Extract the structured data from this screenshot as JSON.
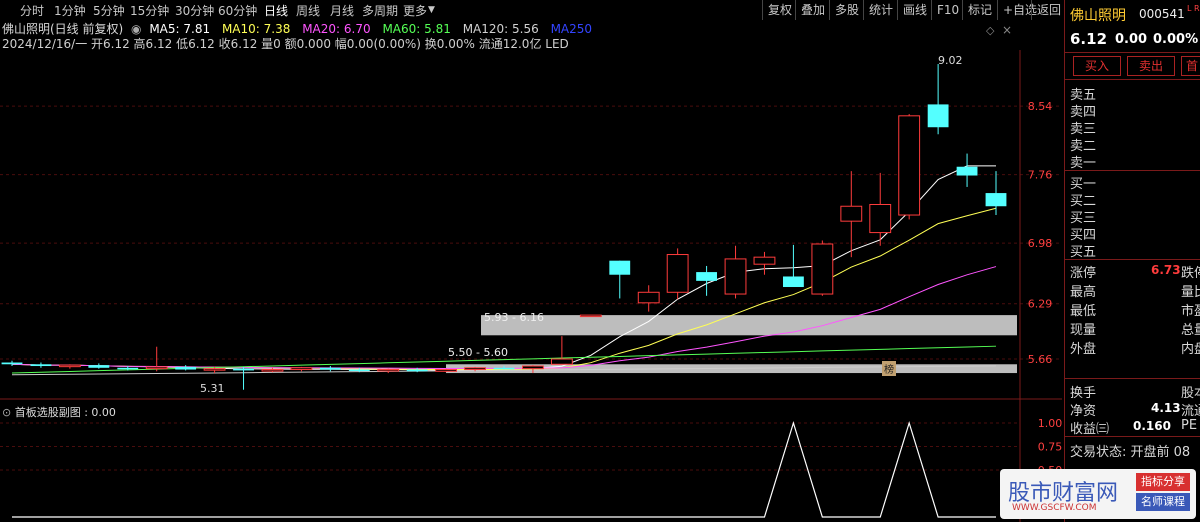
{
  "periods": [
    "分时",
    "1分钟",
    "5分钟",
    "15分钟",
    "30分钟",
    "60分钟",
    "日线",
    "周线",
    "月线",
    "多周期",
    "更多"
  ],
  "active_period": "日线",
  "toolbar": [
    "复权",
    "叠加",
    "多股",
    "统计",
    "画线",
    "F10",
    "标记",
    "+自选",
    "返回"
  ],
  "title": {
    "name": "佛山照明(日线 前复权)",
    "ma5": "MA5: 7.81",
    "ma10": "MA10: 7.38",
    "ma20": "MA20: 6.70",
    "ma60": "MA60: 5.81",
    "ma120": "MA120: 5.56",
    "ma250": "MA250"
  },
  "info": "2024/12/16/一 开6.12 高6.12 低6.12 收6.12 量0 额0.000 幅0.00(0.00%) 换0.00% 流通12.0亿 LED",
  "y_labels": [
    "8.54",
    "7.76",
    "6.98",
    "6.29",
    "5.66"
  ],
  "annotations": {
    "high": "9.02",
    "low": "5.31",
    "zone1": "5.93 - 6.16",
    "zone2": "5.50 - 5.60",
    "bang": "榜"
  },
  "sub": {
    "title": "首板选股副图 : 0.00",
    "labels": [
      "1.00",
      "0.75",
      "0.50"
    ]
  },
  "right": {
    "name": "佛山照明",
    "code": "000541",
    "tag": "L R",
    "price": "6.12",
    "change": "0.00",
    "pct": "0.00%",
    "buy": "买入",
    "sell": "卖出",
    "more": "首",
    "sells": [
      "卖五",
      "卖四",
      "卖三",
      "卖二",
      "卖一"
    ],
    "buys": [
      "买一",
      "买二",
      "买三",
      "买四",
      "买五"
    ],
    "stats": [
      {
        "label": "涨停",
        "value": "6.73",
        "tail": "跌停"
      },
      {
        "label": "最高",
        "value": "",
        "tail": "量比"
      },
      {
        "label": "最低",
        "value": "",
        "tail": "市盈"
      },
      {
        "label": "现量",
        "value": "",
        "tail": "总量"
      },
      {
        "label": "外盘",
        "value": "",
        "tail": "内盘"
      }
    ],
    "stats2": [
      {
        "label": "换手",
        "value": "",
        "tail": "股本"
      },
      {
        "label": "净资",
        "value": "4.13",
        "tail": "流通"
      },
      {
        "label": "收益㈢",
        "value": "0.160",
        "tail": "PE"
      }
    ],
    "trade_state": "交易状态: 开盘前 08"
  },
  "watermark": {
    "main": "股市财富网",
    "sub1": "指标分享",
    "sub2": "名师课程",
    "url": "WWW.GSCFW.COM"
  },
  "colors": {
    "up": "#ff3c3c",
    "down": "#54ffff",
    "ma5": "#ffffff",
    "ma10": "#ffff55",
    "ma20": "#ff55ff",
    "ma60": "#55ff55",
    "ma120": "#cccccc",
    "grid": "#4a0d0d",
    "axis_text": "#ff4040"
  },
  "chart_data": {
    "type": "candlestick",
    "ylim": [
      5.25,
      9.1
    ],
    "candles": [
      {
        "o": 5.62,
        "h": 5.64,
        "l": 5.58,
        "c": 5.6
      },
      {
        "o": 5.6,
        "h": 5.62,
        "l": 5.56,
        "c": 5.58
      },
      {
        "o": 5.58,
        "h": 5.6,
        "l": 5.55,
        "c": 5.59
      },
      {
        "o": 5.59,
        "h": 5.61,
        "l": 5.55,
        "c": 5.56
      },
      {
        "o": 5.56,
        "h": 5.58,
        "l": 5.53,
        "c": 5.55
      },
      {
        "o": 5.55,
        "h": 5.8,
        "l": 5.52,
        "c": 5.57
      },
      {
        "o": 5.57,
        "h": 5.59,
        "l": 5.53,
        "c": 5.54
      },
      {
        "o": 5.54,
        "h": 5.57,
        "l": 5.5,
        "c": 5.55
      },
      {
        "o": 5.55,
        "h": 5.57,
        "l": 5.31,
        "c": 5.53
      },
      {
        "o": 5.53,
        "h": 5.56,
        "l": 5.51,
        "c": 5.54
      },
      {
        "o": 5.54,
        "h": 5.57,
        "l": 5.52,
        "c": 5.56
      },
      {
        "o": 5.56,
        "h": 5.58,
        "l": 5.52,
        "c": 5.54
      },
      {
        "o": 5.54,
        "h": 5.56,
        "l": 5.51,
        "c": 5.53
      },
      {
        "o": 5.53,
        "h": 5.55,
        "l": 5.5,
        "c": 5.54
      },
      {
        "o": 5.54,
        "h": 5.56,
        "l": 5.51,
        "c": 5.52
      },
      {
        "o": 5.52,
        "h": 5.55,
        "l": 5.51,
        "c": 5.54
      },
      {
        "o": 5.54,
        "h": 5.57,
        "l": 5.52,
        "c": 5.56
      },
      {
        "o": 5.56,
        "h": 5.58,
        "l": 5.54,
        "c": 5.55
      },
      {
        "o": 5.55,
        "h": 5.59,
        "l": 5.5,
        "c": 5.58
      },
      {
        "o": 5.6,
        "h": 5.92,
        "l": 5.6,
        "c": 5.66
      },
      {
        "o": 6.16,
        "h": 6.16,
        "l": 6.16,
        "c": 6.16
      },
      {
        "o": 6.78,
        "h": 6.78,
        "l": 6.35,
        "c": 6.62
      },
      {
        "o": 6.3,
        "h": 6.5,
        "l": 6.2,
        "c": 6.42
      },
      {
        "o": 6.42,
        "h": 6.92,
        "l": 6.34,
        "c": 6.85
      },
      {
        "o": 6.65,
        "h": 6.72,
        "l": 6.38,
        "c": 6.55
      },
      {
        "o": 6.4,
        "h": 6.95,
        "l": 6.35,
        "c": 6.8
      },
      {
        "o": 6.74,
        "h": 6.88,
        "l": 6.62,
        "c": 6.82
      },
      {
        "o": 6.6,
        "h": 6.96,
        "l": 6.5,
        "c": 6.48
      },
      {
        "o": 6.4,
        "h": 7.01,
        "l": 6.38,
        "c": 6.97
      },
      {
        "o": 7.23,
        "h": 7.8,
        "l": 6.82,
        "c": 7.4
      },
      {
        "o": 7.1,
        "h": 7.78,
        "l": 6.95,
        "c": 7.42
      },
      {
        "o": 7.3,
        "h": 8.45,
        "l": 7.25,
        "c": 8.43
      },
      {
        "o": 8.56,
        "h": 9.02,
        "l": 8.22,
        "c": 8.3
      },
      {
        "o": 7.85,
        "h": 8.0,
        "l": 7.62,
        "c": 7.75
      },
      {
        "o": 7.55,
        "h": 7.8,
        "l": 7.3,
        "c": 7.4
      }
    ],
    "sub_series": [
      0,
      0,
      0,
      0,
      0,
      0,
      0,
      0,
      0,
      0,
      0,
      0,
      0,
      0,
      0,
      0,
      0,
      0,
      0,
      0,
      0,
      0,
      0,
      0,
      0,
      0,
      0,
      1.0,
      0,
      0,
      0,
      1.0,
      0,
      0,
      0
    ]
  }
}
